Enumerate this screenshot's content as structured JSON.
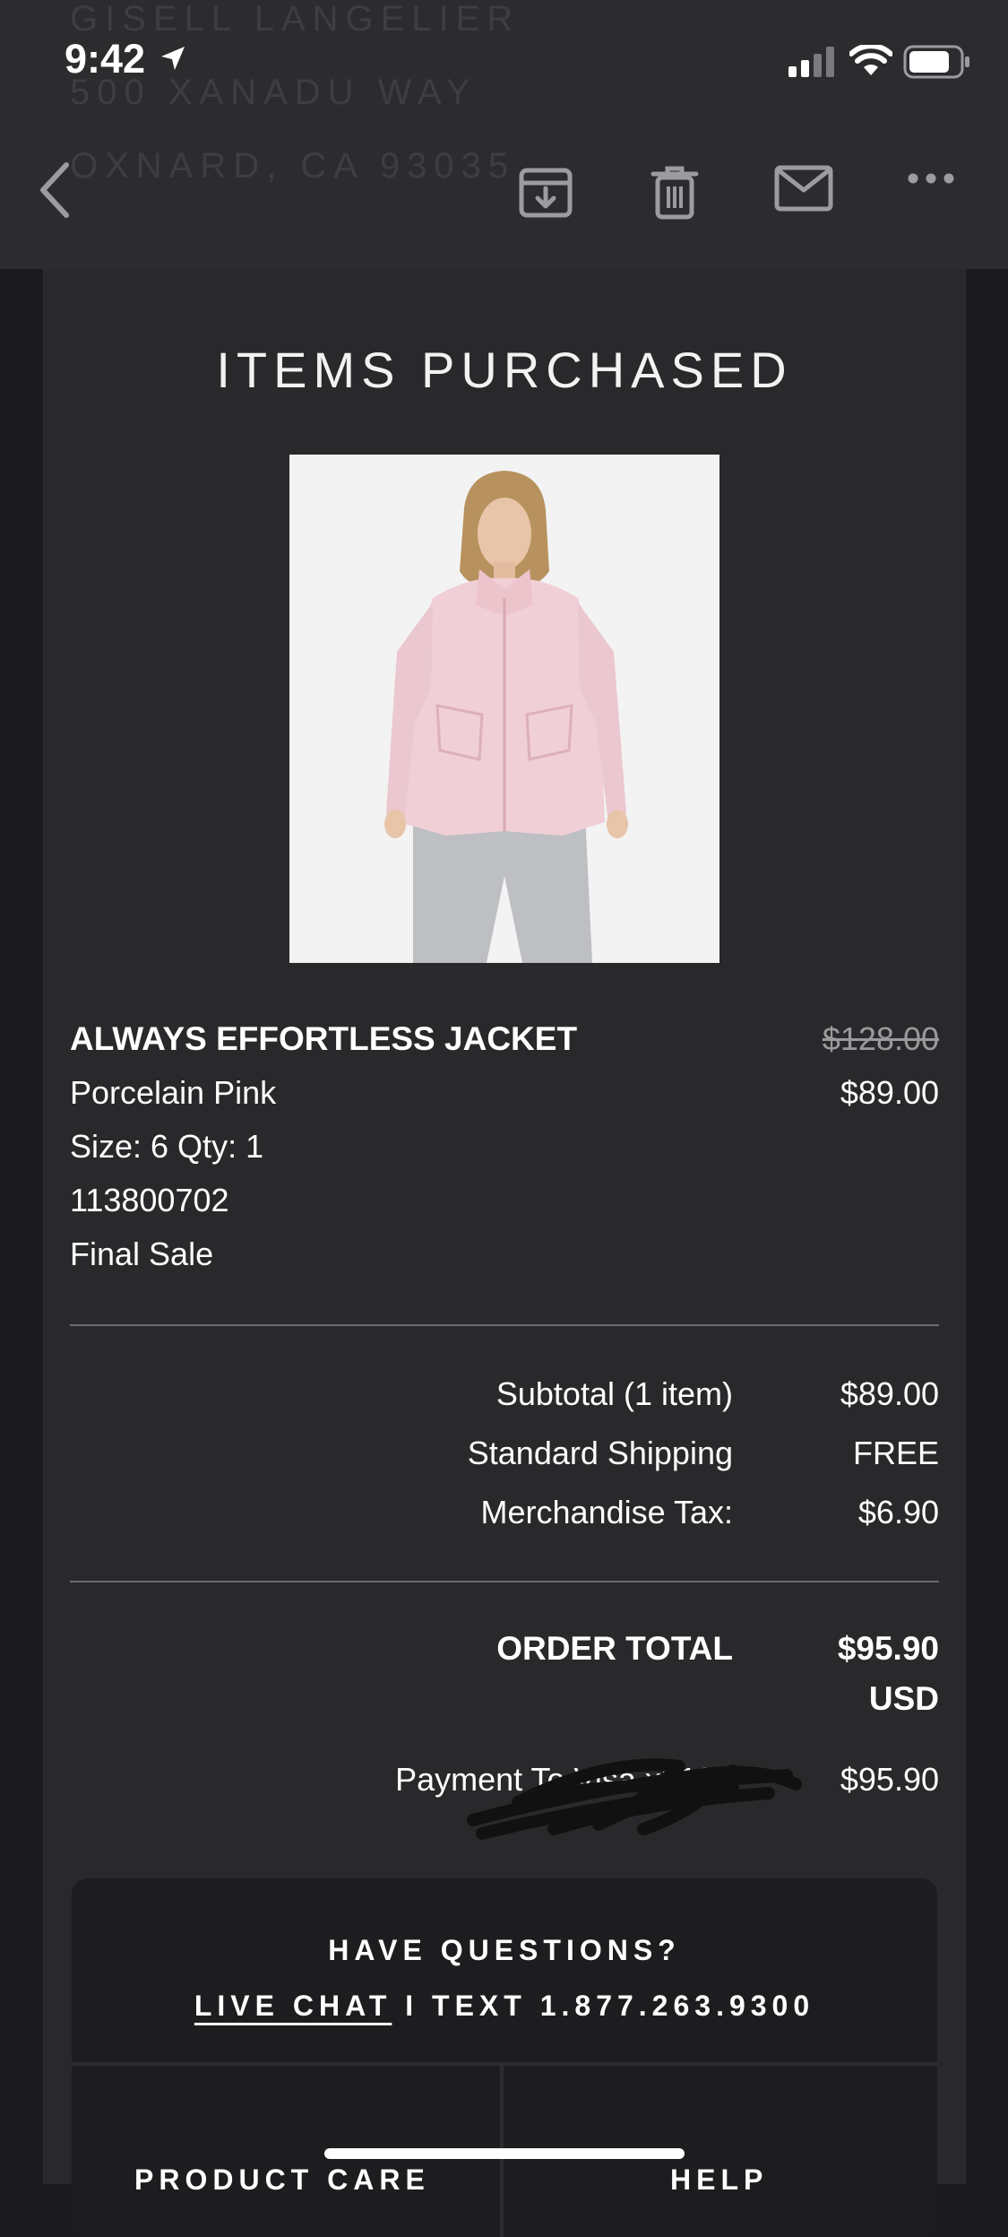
{
  "status_bar": {
    "time": "9:42"
  },
  "background_address": [
    "GISELL LANGELIER",
    "500 XANADU WAY",
    "OXNARD, CA 93035"
  ],
  "nav": {
    "icons": [
      "back-icon",
      "archive-icon",
      "trash-icon",
      "mail-icon",
      "more-icon"
    ]
  },
  "order": {
    "section_title": "ITEMS PURCHASED",
    "item": {
      "name": "ALWAYS EFFORTLESS JACKET",
      "color": "Porcelain Pink",
      "size_qty": "Size: 6 Qty: 1",
      "sku": "113800702",
      "note": "Final Sale",
      "original_price": "$128.00",
      "sale_price": "$89.00"
    },
    "summary": [
      {
        "label": "Subtotal (1 item)",
        "value": "$89.00"
      },
      {
        "label": "Standard Shipping",
        "value": "FREE"
      },
      {
        "label": "Merchandise Tax:",
        "value": "$6.90"
      }
    ],
    "total": {
      "label": "ORDER TOTAL",
      "value": "$95.90",
      "currency": "USD"
    },
    "payment": {
      "label": "Payment To Visa x2137",
      "value": "$95.90"
    }
  },
  "help": {
    "title": "HAVE QUESTIONS?",
    "live_chat": "LIVE CHAT",
    "separator": "I",
    "text_line": "TEXT 1.877.263.9300",
    "links": [
      "PRODUCT CARE",
      "HELP"
    ]
  },
  "colors": {
    "topbar": "#2c2c2f",
    "card": "#29292c",
    "page": "#1b1b1e",
    "help_box": "#1d1d20",
    "jacket": "#f0cfd6"
  }
}
